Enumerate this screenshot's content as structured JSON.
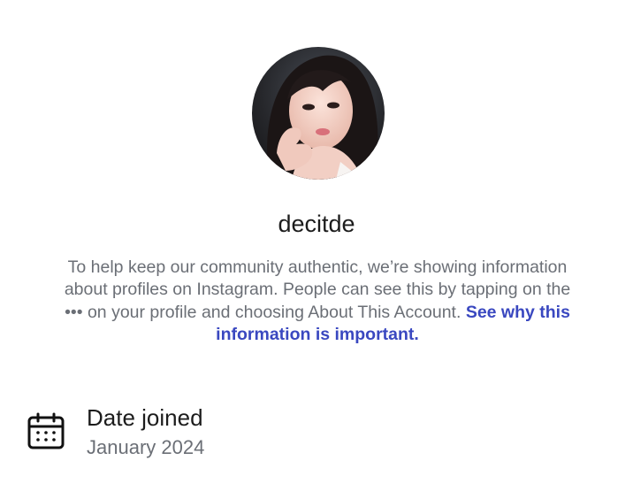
{
  "profile": {
    "username": "decitde",
    "avatar_alt": "profile photo"
  },
  "about": {
    "text_before": "To help keep our community authentic, we’re showing information about profiles on Instagram. People can see this by tapping on the ••• on your profile and choosing About This Account. ",
    "link_text": "See why this information is important."
  },
  "details": [
    {
      "icon": "calendar-icon",
      "title": "Date joined",
      "value": "January 2024"
    }
  ],
  "colors": {
    "link": "#3a48c0",
    "secondary_text": "#6b6f76",
    "primary_text": "#1c1c1c"
  }
}
